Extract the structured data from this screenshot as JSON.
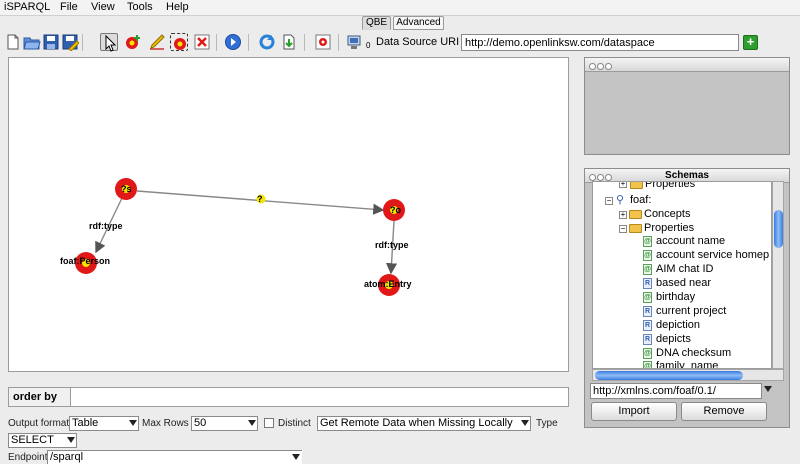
{
  "menu": [
    "iSPARQL",
    "File",
    "View",
    "Tools",
    "Help"
  ],
  "tabs": [
    {
      "label": "QBE",
      "active": true
    },
    {
      "label": "Advanced",
      "active": false
    }
  ],
  "toolbar": {
    "icons": [
      "new-icon",
      "open-icon",
      "save-icon",
      "save-as-icon",
      "pointer-icon",
      "add-node-icon",
      "draw-edge-icon",
      "group-icon",
      "delete-icon",
      "run-icon",
      "refresh-icon",
      "import-icon",
      "link-icon",
      "server-icon"
    ],
    "server_badge": "0",
    "data_source_label": "Data Source URI",
    "data_source_value": "http://demo.openlinksw.com/dataspace"
  },
  "graph": {
    "nodes": [
      {
        "id": "s",
        "label": "?s"
      },
      {
        "id": "o",
        "label": "?o"
      },
      {
        "id": "person",
        "label": "foaf:Person"
      },
      {
        "id": "entry",
        "label": "atom:Entry"
      }
    ],
    "edges": [
      {
        "label": "?"
      },
      {
        "label": "rdf:type"
      },
      {
        "label": "rdf:type"
      }
    ]
  },
  "order_by_label": "order by",
  "controls": {
    "output_format_label": "Output format",
    "output_format_value": "Table",
    "max_rows_label": "Max Rows",
    "max_rows_value": "50",
    "distinct_label": "Distinct",
    "retrieval_value": "Get Remote Data when Missing Locally",
    "type_label": "Type",
    "type_value": "SELECT",
    "endpoint_label": "Endpoint",
    "endpoint_value": "/sparql"
  },
  "schemas": {
    "title": "Schemas",
    "tree_partial_top": "Properties",
    "namespace": "foaf:",
    "folders": [
      "Concepts",
      "Properties"
    ],
    "properties": [
      {
        "label": "account name",
        "kind": "g"
      },
      {
        "label": "account service homep",
        "kind": "g"
      },
      {
        "label": "AIM chat ID",
        "kind": "g"
      },
      {
        "label": "based near",
        "kind": "r"
      },
      {
        "label": "birthday",
        "kind": "g"
      },
      {
        "label": "current project",
        "kind": "r"
      },
      {
        "label": "depiction",
        "kind": "r"
      },
      {
        "label": "depicts",
        "kind": "r"
      },
      {
        "label": "DNA checksum",
        "kind": "g"
      },
      {
        "label": "family_name",
        "kind": "g"
      }
    ],
    "schema_uri": "http://xmlns.com/foaf/0.1/",
    "import_label": "Import",
    "remove_label": "Remove"
  },
  "colors": {
    "node_fill": "#e01818",
    "node_center": "#f2e600",
    "edge": "#888888",
    "window_bg": "#c3c3c3"
  }
}
